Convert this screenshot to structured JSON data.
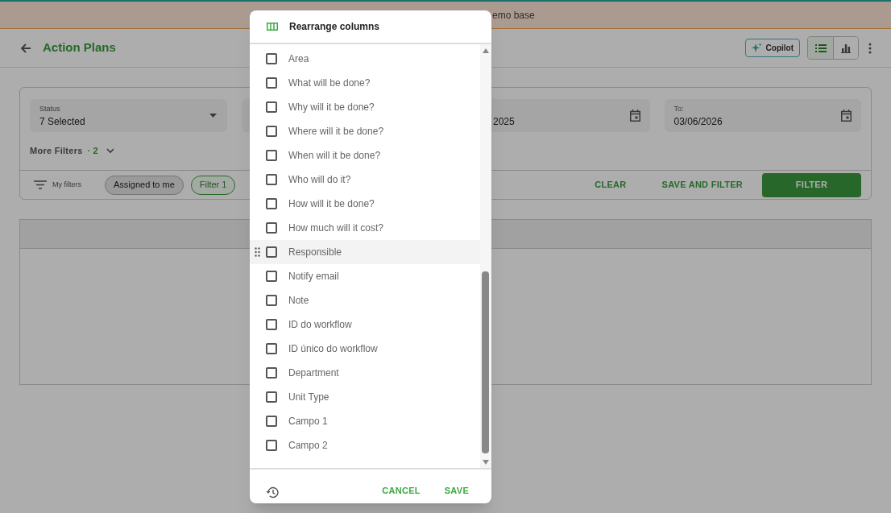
{
  "banner": {
    "text": "emo base"
  },
  "header": {
    "title": "Action Plans",
    "copilot": "Copilot",
    "views": [
      {
        "kind": "list",
        "selected": true
      },
      {
        "kind": "chart",
        "selected": false
      }
    ]
  },
  "filters": {
    "fields": [
      {
        "kind": "select",
        "label": "Status",
        "value": "7 Selected"
      },
      {
        "kind": "hidden"
      },
      {
        "kind": "date",
        "value": "2025"
      },
      {
        "kind": "date",
        "label": "To:",
        "value": "03/06/2026"
      }
    ],
    "more": {
      "label": "More Filters",
      "count": "· 2"
    },
    "my_filters": "My filters",
    "chips": [
      {
        "label": "Assigned to me",
        "selected": false
      },
      {
        "label": "Filter 1",
        "selected": true
      }
    ],
    "actions": {
      "clear": "CLEAR",
      "save_filter": "SAVE AND FILTER",
      "filter": "FILTER"
    }
  },
  "dialog": {
    "title": "Rearrange columns",
    "columns": [
      {
        "label": "Area",
        "checked": false,
        "highlighted": false
      },
      {
        "label": "What will be done?",
        "checked": false,
        "highlighted": false
      },
      {
        "label": "Why will it be done?",
        "checked": false,
        "highlighted": false
      },
      {
        "label": "Where will it be done?",
        "checked": false,
        "highlighted": false
      },
      {
        "label": "When will it be done?",
        "checked": false,
        "highlighted": false
      },
      {
        "label": "Who will do it?",
        "checked": false,
        "highlighted": false
      },
      {
        "label": "How will it be done?",
        "checked": false,
        "highlighted": false
      },
      {
        "label": "How much will it cost?",
        "checked": false,
        "highlighted": false
      },
      {
        "label": "Responsible",
        "checked": false,
        "highlighted": true
      },
      {
        "label": "Notify email",
        "checked": false,
        "highlighted": false
      },
      {
        "label": "Note",
        "checked": false,
        "highlighted": false
      },
      {
        "label": "ID do workflow",
        "checked": false,
        "highlighted": false
      },
      {
        "label": "ID único do workflow",
        "checked": false,
        "highlighted": false
      },
      {
        "label": "Department",
        "checked": false,
        "highlighted": false
      },
      {
        "label": "Unit Type",
        "checked": false,
        "highlighted": false
      },
      {
        "label": "Campo 1",
        "checked": false,
        "highlighted": false
      },
      {
        "label": "Campo 2",
        "checked": false,
        "highlighted": false
      }
    ],
    "cancel": "CANCEL",
    "save": "SAVE"
  }
}
